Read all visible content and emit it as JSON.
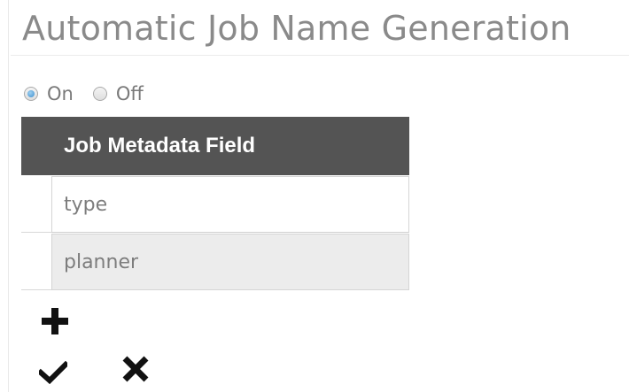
{
  "section": {
    "title": "Automatic Job Name Generation"
  },
  "toggle": {
    "options": [
      {
        "label": "On",
        "checked": true
      },
      {
        "label": "Off",
        "checked": false
      }
    ]
  },
  "table": {
    "header": "Job Metadata Field",
    "rows": [
      {
        "value": "type"
      },
      {
        "value": "planner"
      }
    ]
  },
  "actions": {
    "add_icon": "plus-icon",
    "confirm_icon": "check-icon",
    "cancel_icon": "close-icon"
  }
}
